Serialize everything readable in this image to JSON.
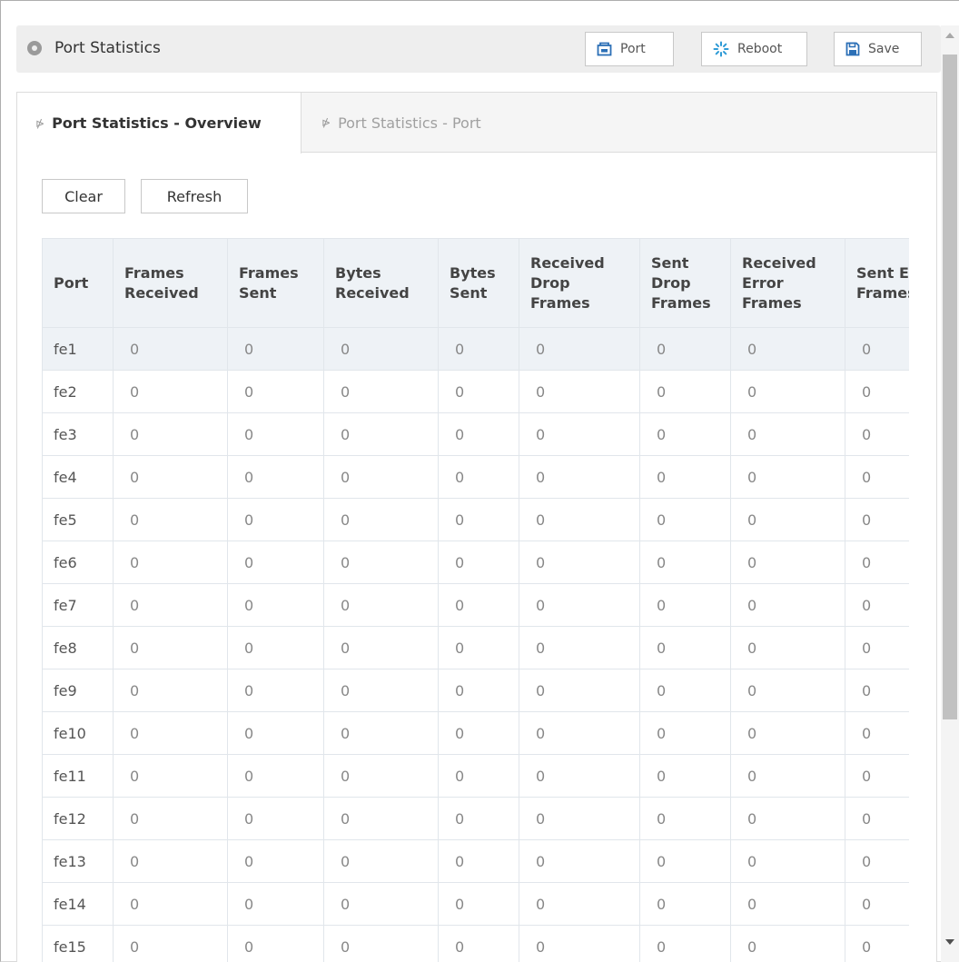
{
  "header": {
    "title": "Port Statistics",
    "buttons": {
      "port": "Port",
      "reboot": "Reboot",
      "save": "Save"
    }
  },
  "tabs": [
    {
      "label": "Port Statistics - Overview",
      "active": true
    },
    {
      "label": "Port Statistics - Port",
      "active": false
    }
  ],
  "actions": {
    "clear": "Clear",
    "refresh": "Refresh"
  },
  "table": {
    "columns": [
      "Port",
      "Frames Received",
      "Frames Sent",
      "Bytes Received",
      "Bytes Sent",
      "Received Drop Frames",
      "Sent Drop Frames",
      "Received Error Frames",
      "Sent Error Frames"
    ],
    "rows": [
      [
        "fe1",
        "0",
        "0",
        "0",
        "0",
        "0",
        "0",
        "0",
        "0"
      ],
      [
        "fe2",
        "0",
        "0",
        "0",
        "0",
        "0",
        "0",
        "0",
        "0"
      ],
      [
        "fe3",
        "0",
        "0",
        "0",
        "0",
        "0",
        "0",
        "0",
        "0"
      ],
      [
        "fe4",
        "0",
        "0",
        "0",
        "0",
        "0",
        "0",
        "0",
        "0"
      ],
      [
        "fe5",
        "0",
        "0",
        "0",
        "0",
        "0",
        "0",
        "0",
        "0"
      ],
      [
        "fe6",
        "0",
        "0",
        "0",
        "0",
        "0",
        "0",
        "0",
        "0"
      ],
      [
        "fe7",
        "0",
        "0",
        "0",
        "0",
        "0",
        "0",
        "0",
        "0"
      ],
      [
        "fe8",
        "0",
        "0",
        "0",
        "0",
        "0",
        "0",
        "0",
        "0"
      ],
      [
        "fe9",
        "0",
        "0",
        "0",
        "0",
        "0",
        "0",
        "0",
        "0"
      ],
      [
        "fe10",
        "0",
        "0",
        "0",
        "0",
        "0",
        "0",
        "0",
        "0"
      ],
      [
        "fe11",
        "0",
        "0",
        "0",
        "0",
        "0",
        "0",
        "0",
        "0"
      ],
      [
        "fe12",
        "0",
        "0",
        "0",
        "0",
        "0",
        "0",
        "0",
        "0"
      ],
      [
        "fe13",
        "0",
        "0",
        "0",
        "0",
        "0",
        "0",
        "0",
        "0"
      ],
      [
        "fe14",
        "0",
        "0",
        "0",
        "0",
        "0",
        "0",
        "0",
        "0"
      ],
      [
        "fe15",
        "0",
        "0",
        "0",
        "0",
        "0",
        "0",
        "0",
        "0"
      ]
    ],
    "selected_row": "fe1"
  },
  "colors": {
    "header_bg": "#eef2f6",
    "selected_row_bg": "#eef2f6",
    "reboot_icon": "#2f9bd6",
    "save_icon": "#2b6fb6",
    "port_icon": "#2b6fb6"
  }
}
